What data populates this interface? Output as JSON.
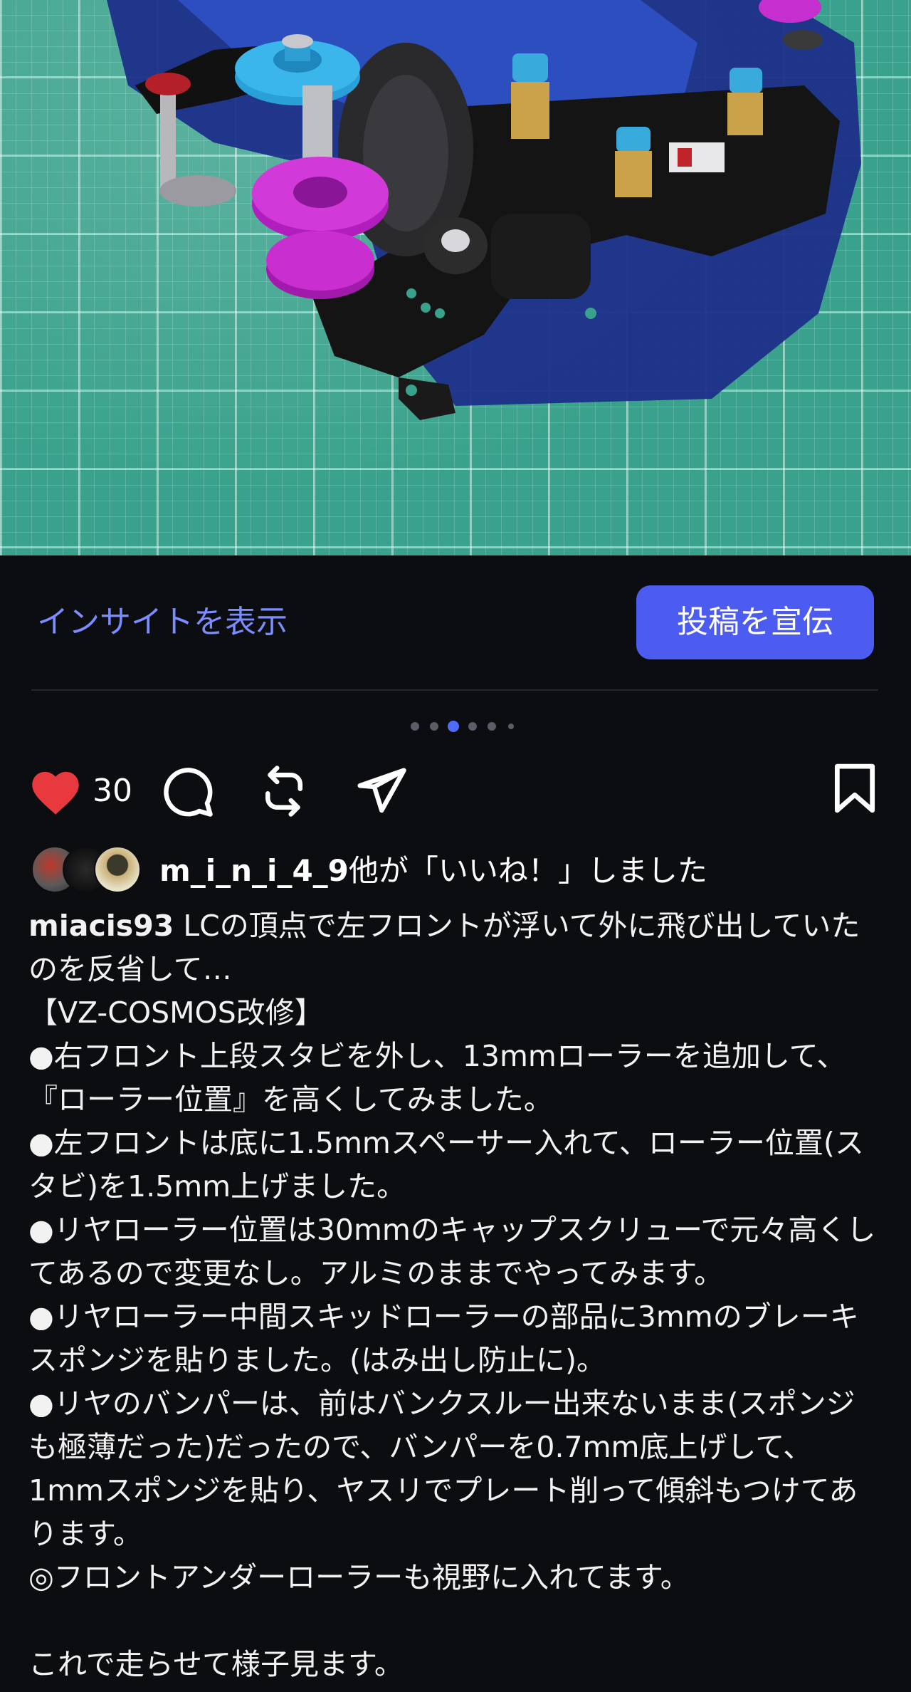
{
  "insights": {
    "link_label": "インサイトを表示",
    "promote_label": "投稿を宣伝"
  },
  "carousel": {
    "slide_count": 6,
    "active_index": 2
  },
  "actions": {
    "like_count": "30",
    "icons": [
      "heart-filled-icon",
      "comment-icon",
      "repost-icon",
      "send-icon",
      "bookmark-icon"
    ],
    "heart_color": "#e8393f"
  },
  "likes": {
    "username": "m_i_n_i_4_9",
    "suffix": "他が「いいね！」しました"
  },
  "caption": {
    "username": "miacis93",
    "first_text": "LCの頂点で左フロントが浮いて外に飛び出していたのを反省して…",
    "lines": [
      "【VZ-COSMOS改修】",
      "●右フロント上段スタビを外し、13mmローラーを追加して、『ローラー位置』を高くしてみました。",
      "●左フロントは底に1.5mmスペーサー入れて、ローラー位置(スタビ)を1.5mm上げました。",
      "●リヤローラー位置は30mmのキャップスクリューで元々高くしてあるので変更なし。アルミのままでやってみます。",
      "●リヤローラー中間スキッドローラーの部品に3mmのブレーキスポンジを貼りました。(はみ出し防止に)。",
      "●リヤのバンパーは、前はバンクスルー出来ないまま(スポンジも極薄だった)だったので、バンパーを0.7mm底上げして、1mmスポンジを貼り、ヤスリでプレート削って傾斜もつけてあります。",
      "◎フロントアンダーローラーも視野に入れてます。",
      "",
      "これで走らせて様子見ます。"
    ]
  },
  "colors": {
    "background": "#0c0d11",
    "accent": "#4d5cf0",
    "link": "#7b8cff"
  }
}
